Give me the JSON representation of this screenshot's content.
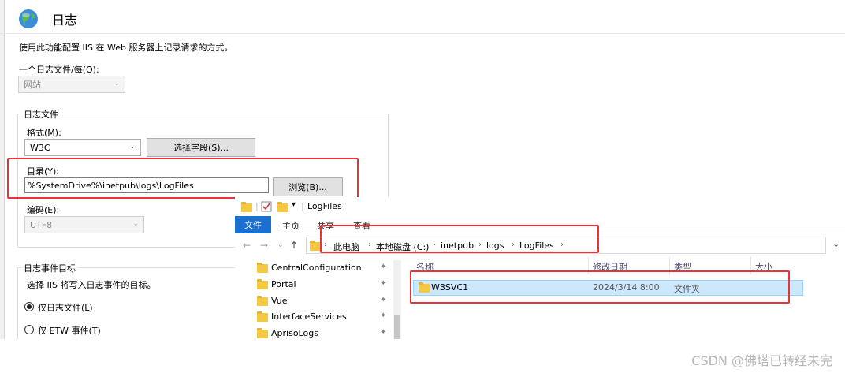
{
  "iis": {
    "title": "日志",
    "description": "使用此功能配置 IIS 在 Web 服务器上记录请求的方式。",
    "one_log_per_label": "一个日志文件/每(O):",
    "one_log_per_value": "网站",
    "logfile_group_title": "日志文件",
    "format_label": "格式(M):",
    "format_value": "W3C",
    "select_fields_button": "选择字段(S)...",
    "directory_label": "目录(Y):",
    "directory_value": "%SystemDrive%\\inetpub\\logs\\LogFiles",
    "browse_button": "浏览(B)...",
    "encoding_label": "编码(E):",
    "encoding_value": "UTF8",
    "log_event_group_title": "日志事件目标",
    "log_event_desc": "选择 IIS 将写入日志事件的目标。",
    "radio_log_file_only": "仅日志文件(L)",
    "radio_etw_only": "仅 ETW 事件(T)"
  },
  "explorer": {
    "window_title": "LogFiles",
    "ribbon_tabs": [
      "文件",
      "主页",
      "共享",
      "查看"
    ],
    "breadcrumb": [
      "此电脑",
      "本地磁盘 (C:)",
      "inetpub",
      "logs",
      "LogFiles"
    ],
    "tree_items": [
      "CentralConfiguration",
      "Portal",
      "Vue",
      "InterfaceServices",
      "AprisoLogs"
    ],
    "columns": [
      "名称",
      "修改日期",
      "类型",
      "大小"
    ],
    "rows": [
      {
        "name": "W3SVC1",
        "modified": "2024/3/14 8:00",
        "type": "文件夹",
        "size": ""
      }
    ]
  },
  "watermark": "CSDN @佛塔已转经未完",
  "colors": {
    "highlight_red": "#e8333a",
    "ribbon_blue": "#1a6fd1",
    "selection": "#cce8ff"
  }
}
